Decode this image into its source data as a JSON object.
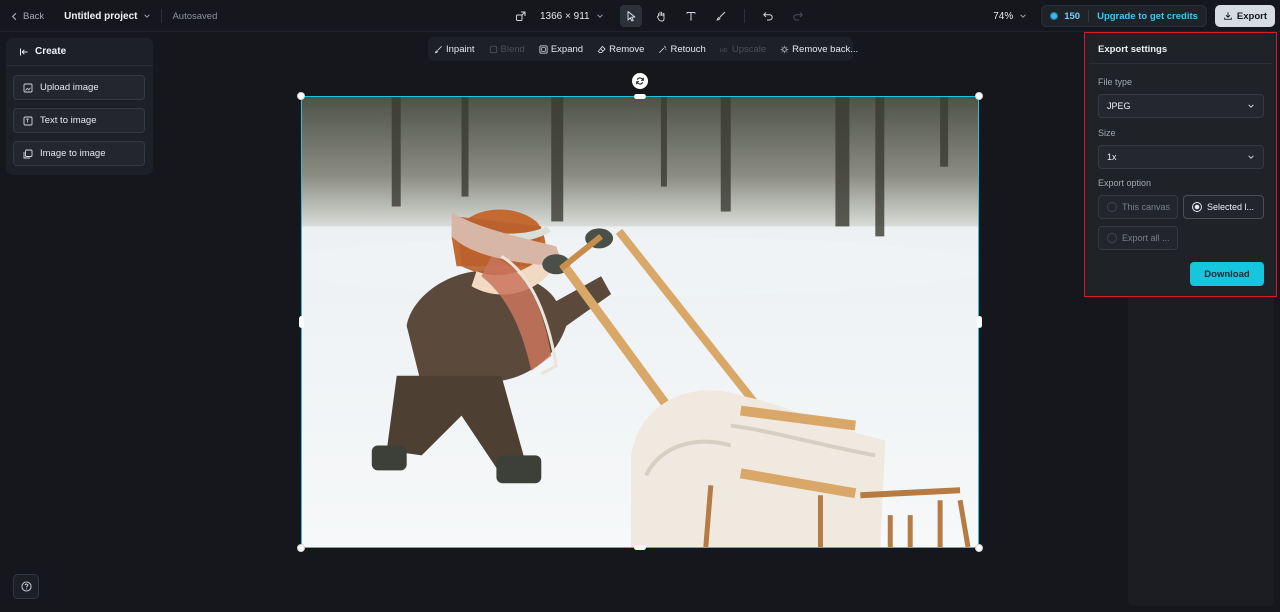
{
  "topbar": {
    "back_label": "Back",
    "project_name": "Untitled project",
    "autosave_status": "Autosaved",
    "canvas_size": "1366 × 911",
    "zoom": "74%",
    "credits": "150",
    "upgrade_label": "Upgrade to get credits",
    "export_label": "Export"
  },
  "left_panel": {
    "title": "Create",
    "items": [
      {
        "label": "Upload image",
        "icon": "upload-image-icon"
      },
      {
        "label": "Text to image",
        "icon": "text-to-image-icon"
      },
      {
        "label": "Image to image",
        "icon": "image-to-image-icon"
      }
    ]
  },
  "subtoolbar": {
    "items": [
      {
        "label": "Inpaint",
        "enabled": true
      },
      {
        "label": "Blend",
        "enabled": false
      },
      {
        "label": "Expand",
        "enabled": true
      },
      {
        "label": "Remove",
        "enabled": true
      },
      {
        "label": "Retouch",
        "enabled": true
      },
      {
        "label": "Upscale",
        "enabled": false
      },
      {
        "label": "Remove back...",
        "enabled": true
      }
    ]
  },
  "export_panel": {
    "title": "Export settings",
    "file_type_label": "File type",
    "file_type_value": "JPEG",
    "size_label": "Size",
    "size_value": "1x",
    "export_option_label": "Export option",
    "options": [
      {
        "label": "This canvas",
        "selected": false
      },
      {
        "label": "Selected l...",
        "selected": true
      },
      {
        "label": "Export all ...",
        "selected": false
      }
    ],
    "download_label": "Download"
  },
  "colors": {
    "accent": "#16c6dc",
    "highlight_border": "#d61c27",
    "background": "#15171c"
  }
}
